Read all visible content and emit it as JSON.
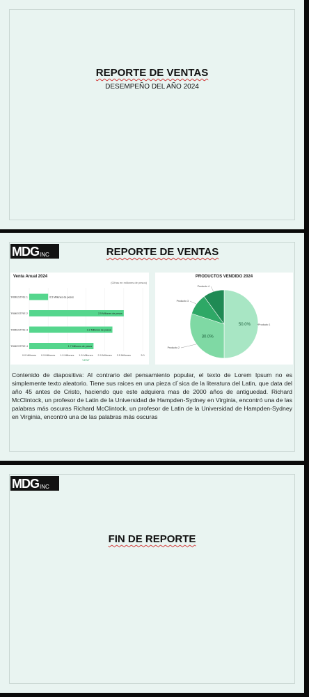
{
  "slide1": {
    "title": "REPORTE DE VENTAS",
    "subtitle": "DESEMPEÑO DEL AÑO 2024"
  },
  "slide2": {
    "logo": {
      "main": "MDG",
      "suffix": "INC"
    },
    "title": "REPORTE DE VENTAS",
    "body": "Contenido de diapositiva: Al contrario del pensamiento popular, el texto de Lorem Ipsum no es simplemente texto aleatorio. Tiene sus raices en una pieza cl´sica de la literatura del Latin, que data del año 45 antes de Cristo, haciendo que este adquiera mas de 2000 años de antiguedad. Richard McClintock, un profesor de Latin de la Universidad de Hampden-Sydney en Virginia, encontró una de las palabras más oscuras Richard McClintock, un profesor de Latin de la Universidad de Hampden-Sydney en Virginia, encontró una de las palabras más oscuras"
  },
  "slide3": {
    "logo": {
      "main": "MDG",
      "suffix": "INC"
    },
    "title": "FIN DE REPORTE"
  },
  "chart_data": [
    {
      "type": "bar",
      "title": "Venta Anual 2024",
      "subtitle": "(Cifras en millones de pesos)",
      "categories": [
        "TRIMESTRE 1",
        "TRIMESTRE 2",
        "TRIMESTRE 3",
        "TRIMESTRE 4"
      ],
      "values": [
        0.5,
        2.5,
        2.2,
        1.7
      ],
      "value_labels": [
        "0.5 Millones de pesos",
        "2.5 Millones de pesos",
        "2.2 Millones de pesos",
        "1.7 Millones de pesos"
      ],
      "xticks": [
        "0.0 Millones",
        "0.5 Millones",
        "1.0 Millones",
        "1.5 Millones",
        "2.0 Millones",
        "2.5 Millones",
        "3.0"
      ],
      "xlim": [
        0,
        3
      ],
      "xlabel": "VENT",
      "colors": [
        "#55d68d"
      ]
    },
    {
      "type": "pie",
      "title": "PRODUCTOS VENDIDO 2024",
      "slices": [
        {
          "label": "Producto 1",
          "value": 50.0,
          "percent_label": "50.0%",
          "color": "#a8e6c4"
        },
        {
          "label": "Producto 2",
          "value": 30.0,
          "percent_label": "30.0%",
          "color": "#7fd9a4"
        },
        {
          "label": "Producto 3",
          "value": 10.0,
          "percent_label": "",
          "color": "#2ea866"
        },
        {
          "label": "Producto 4",
          "value": 10.0,
          "percent_label": "",
          "color": "#1f8a54"
        }
      ]
    }
  ]
}
